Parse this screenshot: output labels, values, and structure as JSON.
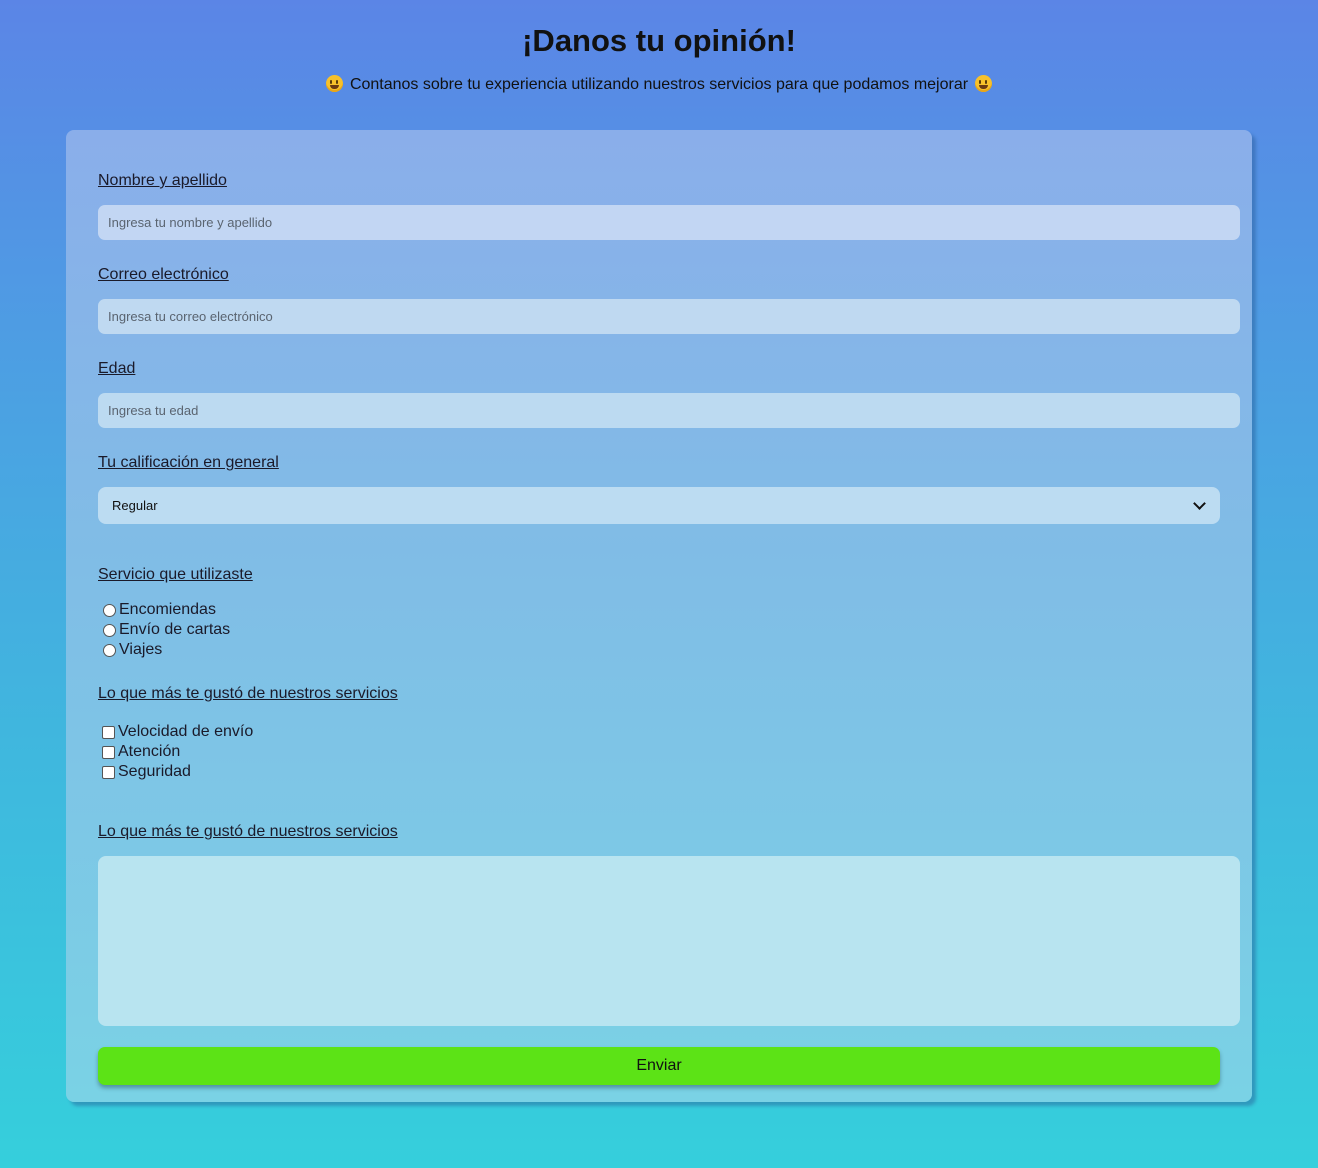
{
  "header": {
    "title": "¡Danos tu opinión!",
    "subtitle": "Contanos sobre tu experiencia utilizando nuestros servicios para que podamos mejorar",
    "emoji_icon": "grinning-face"
  },
  "form": {
    "name": {
      "label": "Nombre y apellido",
      "placeholder": "Ingresa tu nombre y apellido",
      "value": ""
    },
    "email": {
      "label": "Correo electrónico",
      "placeholder": "Ingresa tu correo electrónico",
      "value": ""
    },
    "age": {
      "label": "Edad",
      "placeholder": "Ingresa tu edad",
      "value": ""
    },
    "rating": {
      "label": "Tu calificación en general",
      "selected": "Regular"
    },
    "service": {
      "label": "Servicio que utilizaste",
      "options": [
        "Encomiendas",
        "Envío de cartas",
        "Viajes"
      ]
    },
    "liked": {
      "label": "Lo que más te gustó de nuestros servicios",
      "options": [
        "Velocidad de envío",
        "Atención",
        "Seguridad"
      ]
    },
    "comments": {
      "label": "Lo que más te gustó de nuestros servicios",
      "value": ""
    },
    "submit_label": "Enviar"
  },
  "colors": {
    "submit_button": "#5ce316",
    "background_top": "#5b85e6",
    "background_bottom": "#35cfdc"
  }
}
